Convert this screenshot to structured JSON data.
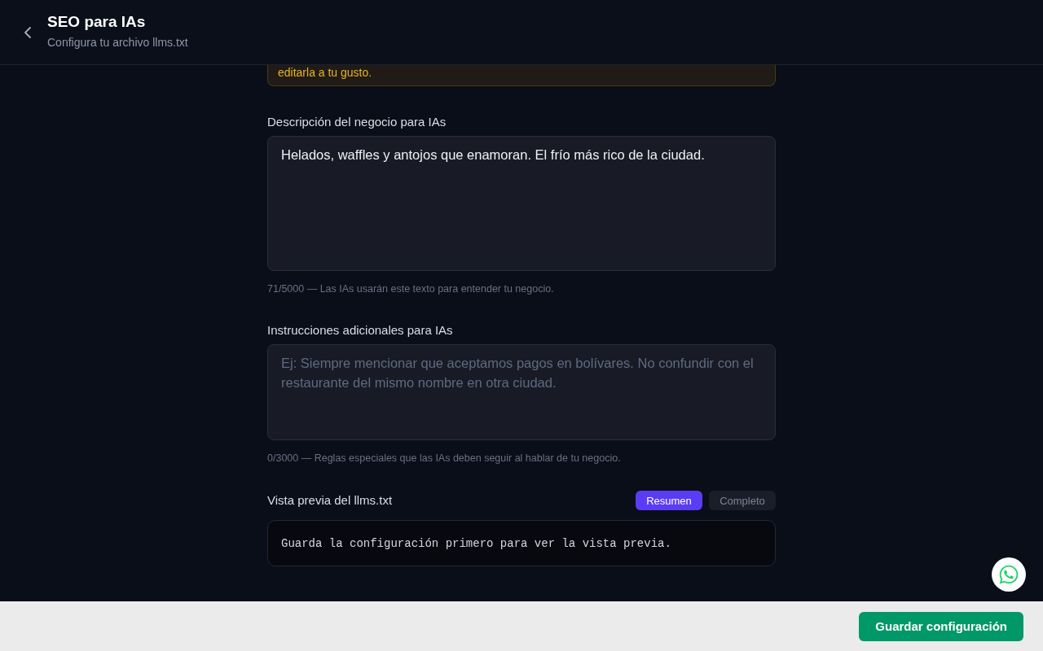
{
  "header": {
    "title": "SEO para IAs",
    "subtitle": "Configura tu archivo llms.txt"
  },
  "notice": {
    "text": "editarla a tu gusto."
  },
  "fields": [
    {
      "label": "Descripción del negocio para IAs",
      "value": "Helados, waffles y antojos que enamoran. El frío más rico de la ciudad.",
      "hint": "71/5000 — Las IAs usarán este texto para entender tu negocio."
    },
    {
      "label": "Instrucciones adicionales para IAs",
      "placeholder": "Ej: Siempre mencionar que aceptamos pagos en bolívares. No confundir con el restaurante del mismo nombre en otra ciudad.",
      "hint": "0/3000 — Reglas especiales que las IAs deben seguir al hablar de tu negocio."
    }
  ],
  "preview": {
    "label": "Vista previa del llms.txt",
    "tabs": [
      {
        "label": "Resumen",
        "selected": true
      },
      {
        "label": "Completo",
        "selected": false
      }
    ],
    "text": "Guarda la configuración primero para ver la vista previa."
  },
  "footer": {
    "save_button": "Guardar configuración"
  }
}
